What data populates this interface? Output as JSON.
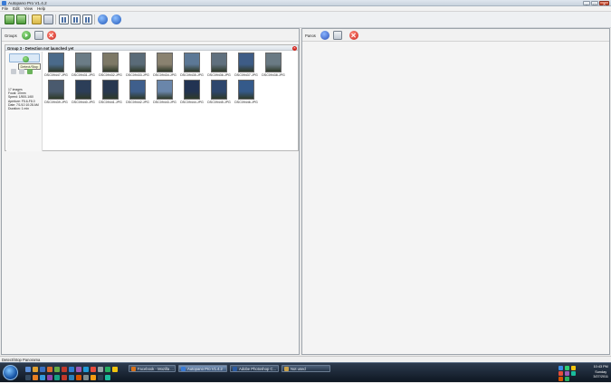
{
  "window": {
    "title": "Autopano Pro V1.4.2",
    "controls": [
      "–",
      "□",
      "✕"
    ]
  },
  "menu": [
    "File",
    "Edit",
    "View",
    "Help"
  ],
  "left_panel": {
    "label": "Groups"
  },
  "right_panel": {
    "label": "Panos"
  },
  "group": {
    "title": "Group 3 - Detection not launched yet",
    "tooltip": "Detect/Stop",
    "info": [
      "17 images",
      "Focal: 10mm",
      "Speed: 1/500-1/60",
      "Aperture: F5.6-F8.0",
      "Date: 7/1/10 10:28 AM",
      "Duration: 1 min"
    ],
    "images": [
      {
        "name": "DSC09447.JPG",
        "color": "#4a6a8a"
      },
      {
        "name": "DSC09431.JPG",
        "color": "#6b7c86"
      },
      {
        "name": "DSC09432.JPG",
        "color": "#7d7866"
      },
      {
        "name": "DSC09433.JPG",
        "color": "#5a6b78"
      },
      {
        "name": "DSC09434.JPG",
        "color": "#8a8270"
      },
      {
        "name": "DSC09435.JPG",
        "color": "#5c7896"
      },
      {
        "name": "DSC09436.JPG",
        "color": "#60707e"
      },
      {
        "name": "DSC09437.JPG",
        "color": "#3e5c86"
      },
      {
        "name": "DSC09438.JPG",
        "color": "#6a7a84"
      },
      {
        "name": "DSC09439.JPG",
        "color": "#4a5a6e"
      },
      {
        "name": "DSC09440.JPG",
        "color": "#2c3e58"
      },
      {
        "name": "DSC09441.JPG",
        "color": "#283850"
      },
      {
        "name": "DSC09442.JPG",
        "color": "#3f5f8c"
      },
      {
        "name": "DSC09443.JPG",
        "color": "#6a86aa"
      },
      {
        "name": "DSC09444.JPG",
        "color": "#223352"
      },
      {
        "name": "DSC09445.JPG",
        "color": "#2e466c"
      },
      {
        "name": "DSC09446.JPG",
        "color": "#355a8a"
      }
    ]
  },
  "status": "Detect/Stop Panorama",
  "taskbar": {
    "buttons": [
      {
        "label": "Facebook - Mozilla ...",
        "color": "#d8731c"
      },
      {
        "label": "Autopano Pro V1.4.2",
        "color": "#3a7bd5"
      },
      {
        "label": "Adobe Photoshop C...",
        "color": "#2a5aa0"
      },
      {
        "label": "Not used",
        "color": "#caa24a"
      }
    ],
    "clock_time": "10:43 PM",
    "clock_day": "Sunday",
    "clock_date": "3/27/2011"
  }
}
